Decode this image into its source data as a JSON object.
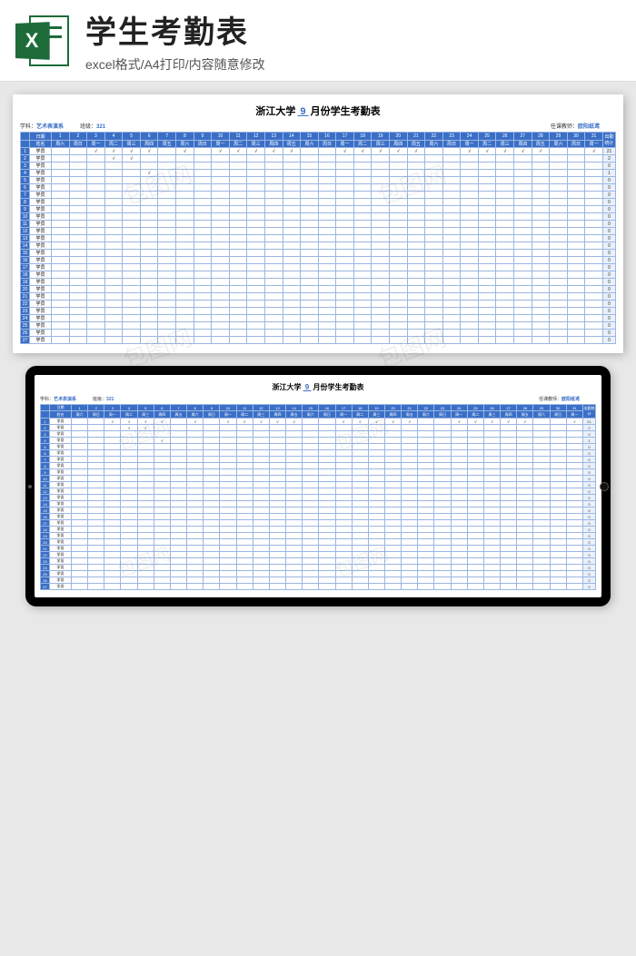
{
  "banner": {
    "title": "学生考勤表",
    "subtitle": "excel格式/A4打印/内容随意修改",
    "icon_letter": "X"
  },
  "sheet": {
    "title_prefix": "浙江大学",
    "month": "9",
    "title_suffix": "月份学生考勤表",
    "meta": {
      "subject_label": "学科：",
      "subject_value": "艺术表演系",
      "class_label": "班级：",
      "class_value": "321",
      "teacher_label": "任课教师：",
      "teacher_value": "欧阳纸鸢"
    },
    "header": {
      "corner_date": "日期",
      "corner_name": "姓名",
      "total_label": "出勤统计",
      "days": [
        1,
        2,
        3,
        4,
        5,
        6,
        7,
        8,
        9,
        10,
        11,
        12,
        13,
        14,
        15,
        16,
        17,
        18,
        19,
        20,
        21,
        22,
        23,
        24,
        25,
        26,
        27,
        28,
        29,
        30,
        31
      ],
      "weekdays": [
        "周六",
        "周日",
        "周一",
        "周二",
        "周三",
        "周四",
        "周五",
        "周六",
        "周日",
        "周一",
        "周二",
        "周三",
        "周四",
        "周五",
        "周六",
        "周日",
        "周一",
        "周二",
        "周三",
        "周四",
        "周五",
        "周六",
        "周日",
        "周一",
        "周二",
        "周三",
        "周四",
        "周五",
        "周六",
        "周日",
        "周一"
      ]
    },
    "students": [
      {
        "idx": 1,
        "name": "学员",
        "marks": {
          "3": "√",
          "4": "√",
          "5": "√",
          "6": "√",
          "8": "√",
          "10": "√",
          "11": "√",
          "12": "√",
          "13": "√",
          "14": "√",
          "17": "√",
          "18": "√",
          "19": "√",
          "20": "√",
          "21": "√",
          "24": "√",
          "25": "√",
          "26": "√",
          "27": "√",
          "28": "√",
          "31": "√"
        },
        "total": 21
      },
      {
        "idx": 2,
        "name": "学员",
        "marks": {
          "4": "√",
          "5": "√"
        },
        "total": 2
      },
      {
        "idx": 3,
        "name": "学员",
        "marks": {},
        "total": 0
      },
      {
        "idx": 4,
        "name": "学员",
        "marks": {
          "6": "√"
        },
        "total": 1
      },
      {
        "idx": 5,
        "name": "学员",
        "marks": {},
        "total": 0
      },
      {
        "idx": 6,
        "name": "学员",
        "marks": {},
        "total": 0
      },
      {
        "idx": 7,
        "name": "学员",
        "marks": {},
        "total": 0
      },
      {
        "idx": 8,
        "name": "学员",
        "marks": {},
        "total": 0
      },
      {
        "idx": 9,
        "name": "学员",
        "marks": {},
        "total": 0
      },
      {
        "idx": 10,
        "name": "学员",
        "marks": {},
        "total": 0
      },
      {
        "idx": 11,
        "name": "学员",
        "marks": {},
        "total": 0
      },
      {
        "idx": 12,
        "name": "学员",
        "marks": {},
        "total": 0
      },
      {
        "idx": 13,
        "name": "学员",
        "marks": {},
        "total": 0
      },
      {
        "idx": 14,
        "name": "学员",
        "marks": {},
        "total": 0
      },
      {
        "idx": 15,
        "name": "学员",
        "marks": {},
        "total": 0
      },
      {
        "idx": 16,
        "name": "学员",
        "marks": {},
        "total": 0
      },
      {
        "idx": 17,
        "name": "学员",
        "marks": {},
        "total": 0
      },
      {
        "idx": 18,
        "name": "学员",
        "marks": {},
        "total": 0
      },
      {
        "idx": 19,
        "name": "学员",
        "marks": {},
        "total": 0
      },
      {
        "idx": 20,
        "name": "学员",
        "marks": {},
        "total": 0
      },
      {
        "idx": 21,
        "name": "学员",
        "marks": {},
        "total": 0
      },
      {
        "idx": 22,
        "name": "学员",
        "marks": {},
        "total": 0
      },
      {
        "idx": 23,
        "name": "学员",
        "marks": {},
        "total": 0
      },
      {
        "idx": 24,
        "name": "学员",
        "marks": {},
        "total": 0
      },
      {
        "idx": 25,
        "name": "学员",
        "marks": {},
        "total": 0
      },
      {
        "idx": 26,
        "name": "学员",
        "marks": {},
        "total": 0
      },
      {
        "idx": 27,
        "name": "学员",
        "marks": {},
        "total": 0
      }
    ]
  },
  "watermark": "包图网"
}
